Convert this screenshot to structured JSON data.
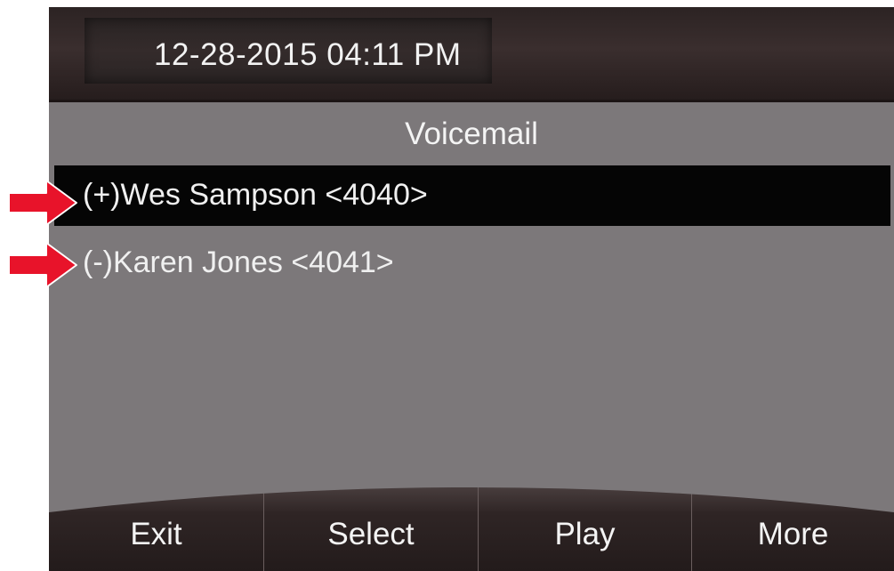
{
  "status_bar": {
    "datetime": "12-28-2015 04:11 PM"
  },
  "screen": {
    "title": "Voicemail"
  },
  "voicemail_list": {
    "items": [
      {
        "label": "(+)Wes Sampson <4040>",
        "selected": true
      },
      {
        "label": "(-)Karen Jones <4041>",
        "selected": false
      }
    ]
  },
  "softkeys": [
    {
      "label": "Exit"
    },
    {
      "label": "Select"
    },
    {
      "label": "Play"
    },
    {
      "label": "More"
    }
  ],
  "annotations": {
    "arrow_color": "#e8132a",
    "arrow_icon": "red-arrow-icon"
  },
  "colors": {
    "screen_background": "#7c787a",
    "selected_row": "#050505",
    "header_bar": "#2c2323",
    "text": "#f2f2f2"
  }
}
